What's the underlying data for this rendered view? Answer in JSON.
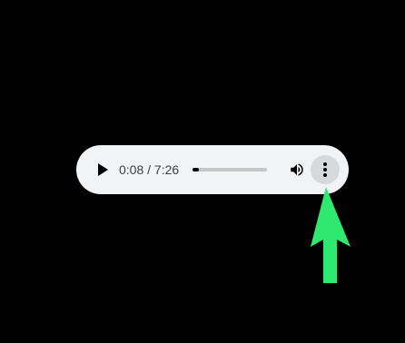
{
  "player": {
    "current_time": "0:08",
    "separator": " / ",
    "duration": "7:26",
    "progress_fraction": 0.018,
    "icons": {
      "play": "play-icon",
      "volume": "volume-icon",
      "more": "more-vert-icon"
    }
  },
  "annotation": {
    "arrow_color": "#2ee86f",
    "points_to": "more-options-button"
  }
}
